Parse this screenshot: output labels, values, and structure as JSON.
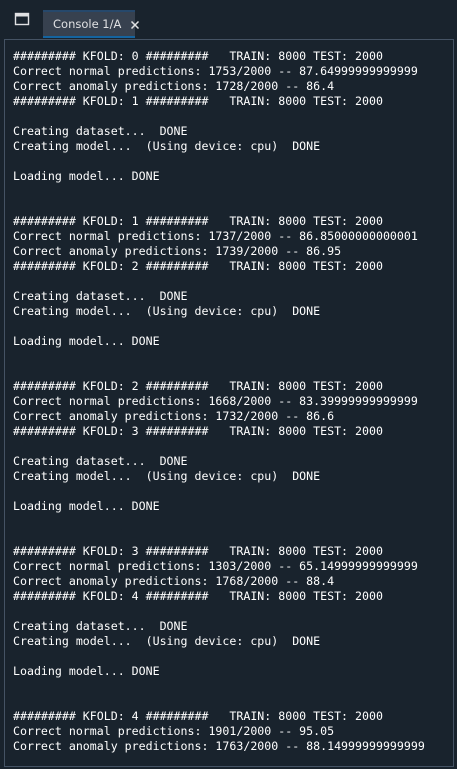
{
  "tab": {
    "label": "Console 1/A"
  },
  "icons": {
    "tab_menu": "window-icon",
    "tab_close": "close-icon"
  },
  "colors": {
    "background": "#19232d",
    "tab_background": "#37414f",
    "tab_accent": "#1464a0",
    "text": "#ffffff"
  },
  "console": {
    "lines": [
      "######### KFOLD: 0 #########   TRAIN: 8000 TEST: 2000",
      "Correct normal predictions: 1753/2000 -- 87.64999999999999",
      "Correct anomaly predictions: 1728/2000 -- 86.4",
      "######### KFOLD: 1 #########   TRAIN: 8000 TEST: 2000",
      "",
      "Creating dataset...  DONE",
      "Creating model...  (Using device: cpu)  DONE",
      "",
      "Loading model... DONE",
      "",
      "",
      "######### KFOLD: 1 #########   TRAIN: 8000 TEST: 2000",
      "Correct normal predictions: 1737/2000 -- 86.85000000000001",
      "Correct anomaly predictions: 1739/2000 -- 86.95",
      "######### KFOLD: 2 #########   TRAIN: 8000 TEST: 2000",
      "",
      "Creating dataset...  DONE",
      "Creating model...  (Using device: cpu)  DONE",
      "",
      "Loading model... DONE",
      "",
      "",
      "######### KFOLD: 2 #########   TRAIN: 8000 TEST: 2000",
      "Correct normal predictions: 1668/2000 -- 83.39999999999999",
      "Correct anomaly predictions: 1732/2000 -- 86.6",
      "######### KFOLD: 3 #########   TRAIN: 8000 TEST: 2000",
      "",
      "Creating dataset...  DONE",
      "Creating model...  (Using device: cpu)  DONE",
      "",
      "Loading model... DONE",
      "",
      "",
      "######### KFOLD: 3 #########   TRAIN: 8000 TEST: 2000",
      "Correct normal predictions: 1303/2000 -- 65.14999999999999",
      "Correct anomaly predictions: 1768/2000 -- 88.4",
      "######### KFOLD: 4 #########   TRAIN: 8000 TEST: 2000",
      "",
      "Creating dataset...  DONE",
      "Creating model...  (Using device: cpu)  DONE",
      "",
      "Loading model... DONE",
      "",
      "",
      "######### KFOLD: 4 #########   TRAIN: 8000 TEST: 2000",
      "Correct normal predictions: 1901/2000 -- 95.05",
      "Correct anomaly predictions: 1763/2000 -- 88.14999999999999"
    ]
  }
}
